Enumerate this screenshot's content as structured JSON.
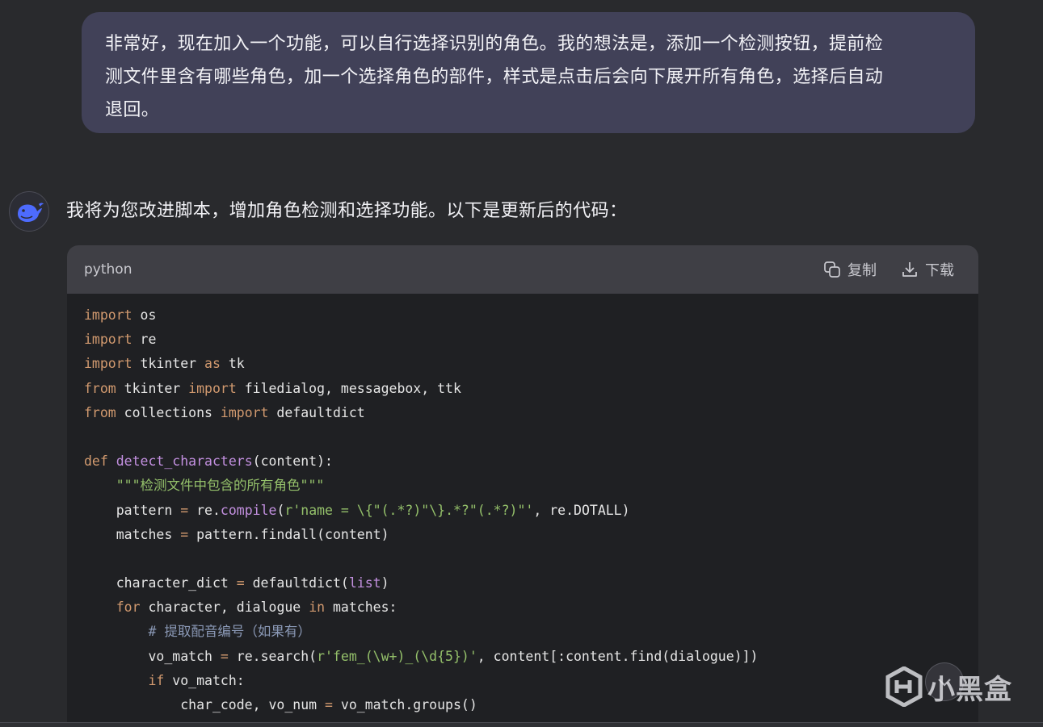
{
  "user_message": {
    "lines": [
      "非常好，现在加入一个功能，可以自行选择识别的角色。我的想法是，添加一个检测按钮，提前检",
      "测文件里含有哪些角色，加一个选择角色的部件，样式是点击后会向下展开所有角色，选择后自动",
      "退回。"
    ]
  },
  "assistant": {
    "avatar_icon": "whale-logo-icon",
    "intro": "我将为您改进脚本，增加角色检测和选择功能。以下是更新后的代码："
  },
  "code_block": {
    "language": "python",
    "copy_label": "复制",
    "download_label": "下载",
    "copy_icon": "copy-icon",
    "download_icon": "download-icon",
    "lines": [
      [
        {
          "t": "import",
          "c": "kw"
        },
        {
          "t": " os"
        }
      ],
      [
        {
          "t": "import",
          "c": "kw"
        },
        {
          "t": " re"
        }
      ],
      [
        {
          "t": "import",
          "c": "kw"
        },
        {
          "t": " tkinter "
        },
        {
          "t": "as",
          "c": "kw"
        },
        {
          "t": " tk"
        }
      ],
      [
        {
          "t": "from",
          "c": "kw"
        },
        {
          "t": " tkinter "
        },
        {
          "t": "import",
          "c": "kw"
        },
        {
          "t": " filedialog, messagebox, ttk"
        }
      ],
      [
        {
          "t": "from",
          "c": "kw"
        },
        {
          "t": " collections "
        },
        {
          "t": "import",
          "c": "kw"
        },
        {
          "t": " defaultdict"
        }
      ],
      [],
      [
        {
          "t": "def",
          "c": "kw"
        },
        {
          "t": " "
        },
        {
          "t": "detect_characters",
          "c": "fn"
        },
        {
          "t": "(content):"
        }
      ],
      [
        {
          "t": "    "
        },
        {
          "t": "\"\"\"检测文件中包含的所有角色\"\"\"",
          "c": "str"
        }
      ],
      [
        {
          "t": "    pattern "
        },
        {
          "t": "=",
          "c": "kw"
        },
        {
          "t": " re."
        },
        {
          "t": "compile",
          "c": "fn"
        },
        {
          "t": "("
        },
        {
          "t": "r'name = \\{\"(.*?)\"\\}.*?\"(.*?)\"'",
          "c": "str"
        },
        {
          "t": ", re.DOTALL)"
        }
      ],
      [
        {
          "t": "    matches "
        },
        {
          "t": "=",
          "c": "kw"
        },
        {
          "t": " pattern.findall(content)"
        }
      ],
      [],
      [
        {
          "t": "    character_dict "
        },
        {
          "t": "=",
          "c": "kw"
        },
        {
          "t": " defaultdict("
        },
        {
          "t": "list",
          "c": "fn"
        },
        {
          "t": ")"
        }
      ],
      [
        {
          "t": "    "
        },
        {
          "t": "for",
          "c": "kw"
        },
        {
          "t": " character, dialogue "
        },
        {
          "t": "in",
          "c": "kw"
        },
        {
          "t": " matches:"
        }
      ],
      [
        {
          "t": "        "
        },
        {
          "t": "# 提取配音编号（如果有）",
          "c": "cm"
        }
      ],
      [
        {
          "t": "        vo_match "
        },
        {
          "t": "=",
          "c": "kw"
        },
        {
          "t": " re.search("
        },
        {
          "t": "r'fem_(\\w+)_(\\d{5})'",
          "c": "str"
        },
        {
          "t": ", content[:content.find(dialogue)])"
        }
      ],
      [
        {
          "t": "        "
        },
        {
          "t": "if",
          "c": "kw"
        },
        {
          "t": " vo_match:"
        }
      ],
      [
        {
          "t": "            char_code, vo_num "
        },
        {
          "t": "=",
          "c": "kw"
        },
        {
          "t": " vo_match.groups()"
        }
      ]
    ]
  },
  "watermark": {
    "text": "小黑盒",
    "icon": "heybox-logo-icon"
  },
  "scroll_button": {
    "icon": "scroll-down-icon"
  }
}
